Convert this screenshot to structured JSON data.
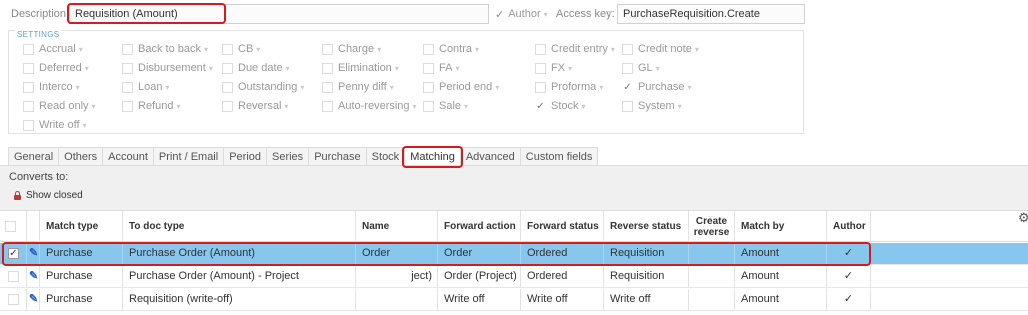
{
  "header": {
    "description_label": "Description:",
    "description_value": "Requisition (Amount)",
    "author_label": "Author",
    "access_key_label": "Access key:",
    "access_key_value": "PurchaseRequisition.Create"
  },
  "settings": {
    "title": "SETTINGS",
    "options": [
      {
        "label": "Accrual",
        "checked": false
      },
      {
        "label": "Back to back",
        "checked": false
      },
      {
        "label": "CB",
        "checked": false
      },
      {
        "label": "Charge",
        "checked": false
      },
      {
        "label": "Contra",
        "checked": false
      },
      {
        "label": "Credit entry",
        "checked": false
      },
      {
        "label": "Credit note",
        "checked": false
      },
      {
        "label": "Deferred",
        "checked": false
      },
      {
        "label": "Disbursement",
        "checked": false
      },
      {
        "label": "Due date",
        "checked": false
      },
      {
        "label": "Elimination",
        "checked": false
      },
      {
        "label": "FA",
        "checked": false
      },
      {
        "label": "FX",
        "checked": false
      },
      {
        "label": "GL",
        "checked": false
      },
      {
        "label": "Interco",
        "checked": false
      },
      {
        "label": "Loan",
        "checked": false
      },
      {
        "label": "Outstanding",
        "checked": false
      },
      {
        "label": "Penny diff",
        "checked": false
      },
      {
        "label": "Period end",
        "checked": false
      },
      {
        "label": "Proforma",
        "checked": false
      },
      {
        "label": "Purchase",
        "checked": true
      },
      {
        "label": "Read only",
        "checked": false
      },
      {
        "label": "Refund",
        "checked": false
      },
      {
        "label": "Reversal",
        "checked": false
      },
      {
        "label": "Auto-reversing",
        "checked": false
      },
      {
        "label": "Sale",
        "checked": false
      },
      {
        "label": "Stock",
        "checked": true
      },
      {
        "label": "System",
        "checked": false
      },
      {
        "label": "Write off",
        "checked": false
      }
    ]
  },
  "tabs": [
    "General",
    "Others",
    "Account",
    "Print / Email",
    "Period",
    "Series",
    "Purchase",
    "Stock",
    "Matching",
    "Advanced",
    "Custom fields"
  ],
  "active_tab": "Matching",
  "matching": {
    "converts_to": "Converts to:",
    "show_closed": "Show closed",
    "columns": {
      "match_type": "Match type",
      "to_doc_type": "To doc type",
      "name": "Name",
      "forward_action": "Forward action",
      "forward_status": "Forward status",
      "reverse_status": "Reverse status",
      "create_reverse_1": "Create",
      "create_reverse_2": "reverse",
      "match_by": "Match by",
      "author": "Author"
    },
    "rows": [
      {
        "checked": true,
        "match_type": "Purchase",
        "to_doc_type": "Purchase Order (Amount)",
        "name": "Order",
        "forward_action": "Order",
        "forward_status": "Ordered",
        "reverse_status": "Requisition",
        "match_by": "Amount",
        "author": "✓",
        "selected": true
      },
      {
        "checked": false,
        "match_type": "Purchase",
        "to_doc_type": "Purchase Order (Amount) - Project",
        "name": "ject)",
        "forward_action": "Order (Project)",
        "forward_status": "Ordered",
        "reverse_status": "Requisition",
        "match_by": "Amount",
        "author": "✓",
        "selected": false
      },
      {
        "checked": false,
        "match_type": "Purchase",
        "to_doc_type": "Requisition (write-off)",
        "name": "",
        "forward_action": "Write off",
        "forward_status": "Write off",
        "reverse_status": "Write off",
        "match_by": "Amount",
        "author": "✓",
        "selected": false
      }
    ]
  },
  "colors": {
    "selected_row": "#87c7ed",
    "highlight_box": "#d41c1c",
    "settings_title": "#5b9fd6"
  }
}
